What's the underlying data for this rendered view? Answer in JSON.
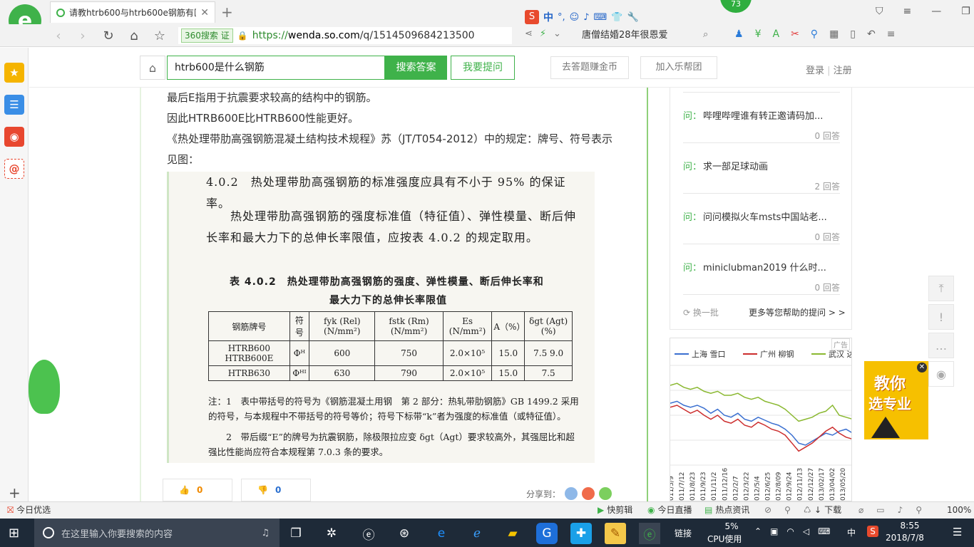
{
  "browser": {
    "tab_title": "请教htrb600与htrb600e钢筋有区",
    "new_tab": "+",
    "badge": "360搜索",
    "badge_cert": "证",
    "url_scheme": "https://",
    "url_host": "wenda.so.com",
    "url_path": "/q/1514509684213500",
    "search_hint": "唐僧结婚28年很恩爱",
    "notif_count": "73",
    "brand_colors": {
      "accent": "#3fb24a",
      "tab_active": "#ffffff"
    }
  },
  "site": {
    "search_value": "htrb600是什么钢筋",
    "search_button": "搜索答案",
    "ask_button": "我要提问",
    "earn_button": "去答题赚金币",
    "join_button": "加入乐帮团",
    "login": "登录",
    "register": "注册"
  },
  "answer": {
    "line1": "最后E指用于抗震要求较高的结构中的钢筋。",
    "line2": "因此HTRB600E比HTRB600性能更好。",
    "line3": "《热处理带肋高强钢筋混凝土结构技术规程》苏（JT/T054-2012）中的规定：牌号、符号表示见图：",
    "figure": {
      "p1": "4.0.2　热处理带肋高强钢筋的标准强度应具有不小于 95% 的保证率。",
      "p2": "　　热处理带肋高强钢筋的强度标准值（特征值）、弹性模量、断后伸长率和最大力下的总伸长率限值，应按表 4.0.2 的规定取用。",
      "table_title1": "表 4.0.2　热处理带肋高强钢筋的强度、弹性模量、断后伸长率和",
      "table_title2": "最大力下的总伸长率限值",
      "headers": [
        "钢筋牌号",
        "符号",
        "fyk (Rel) (N/mm²)",
        "fstk (Rm) (N/mm²)",
        "Es (N/mm²)",
        "A（%）",
        "δgt (Agt) (%)"
      ],
      "rows": [
        [
          "HTRB600 HTRB600E",
          "Φᴴ",
          "600",
          "750",
          "2.0×10⁵",
          "15.0",
          "7.5 9.0"
        ],
        [
          "HTRB630",
          "Φᴴᴵ",
          "630",
          "790",
          "2.0×10⁵",
          "15.0",
          "7.5"
        ]
      ],
      "note1": "注：1　表中带括号的符号为《钢筋混凝土用钢　第 2 部分：热轧带肋钢筋》GB 1499.2 采用的符号，与本规程中不带括号的符号等价；符号下标带“k”者为强度的标准值（或特征值）。",
      "note2": "　　2　带后缀“E”的牌号为抗震钢筋，除极限拉应变 δgt（Agt）要求较高外，其强屈比和超强比性能尚应符合本规程第 7.0.3 条的要求。"
    },
    "likes": "0",
    "dislikes": "0",
    "share_label": "分享到："
  },
  "sidebar": {
    "questions": [
      {
        "prefix": "问：",
        "text": "哔哩哔哩谁有转正邀请码加...",
        "answers": "0 回答"
      },
      {
        "prefix": "问：",
        "text": "求一部足球动画",
        "answers": "2 回答"
      },
      {
        "prefix": "问：",
        "text": "问问模拟火车msts中国站老...",
        "answers": "0 回答"
      },
      {
        "prefix": "问：",
        "text": "miniclubman2019 什么时...",
        "answers": "0 回答"
      }
    ],
    "refresh": "换一批",
    "more": "更多等您帮助的提问 > >"
  },
  "chart_data": {
    "type": "line",
    "legend": [
      "上海 雪口",
      "广州 柳钢",
      "武汉 达"
    ],
    "ad_label": "广告",
    "series": [
      {
        "name": "上海 雪口",
        "color": "#3a6fd0",
        "values": [
          0.62,
          0.64,
          0.6,
          0.58,
          0.6,
          0.57,
          0.52,
          0.56,
          0.5,
          0.48,
          0.52,
          0.46,
          0.44,
          0.48,
          0.45,
          0.42,
          0.4,
          0.36,
          0.3,
          0.22,
          0.2,
          0.24,
          0.28,
          0.32,
          0.3,
          0.34,
          0.36,
          0.32
        ]
      },
      {
        "name": "广州 柳钢",
        "color": "#cc2d2d",
        "values": [
          0.58,
          0.6,
          0.56,
          0.52,
          0.55,
          0.5,
          0.46,
          0.5,
          0.44,
          0.42,
          0.46,
          0.4,
          0.38,
          0.43,
          0.4,
          0.36,
          0.34,
          0.3,
          0.22,
          0.14,
          0.18,
          0.22,
          0.28,
          0.34,
          0.38,
          0.32,
          0.28,
          0.26
        ]
      },
      {
        "name": "武汉 达",
        "color": "#8ab830",
        "values": [
          0.8,
          0.82,
          0.78,
          0.76,
          0.78,
          0.74,
          0.72,
          0.74,
          0.7,
          0.7,
          0.72,
          0.68,
          0.66,
          0.68,
          0.64,
          0.62,
          0.6,
          0.56,
          0.5,
          0.44,
          0.46,
          0.48,
          0.52,
          0.54,
          0.6,
          0.5,
          0.48,
          0.46
        ]
      }
    ],
    "x_labels": [
      "011/5/9",
      "011/7/12",
      "011/8/23",
      "011/9/23",
      "011/11/2",
      "011/12/16",
      "012/2/7",
      "012/3/22",
      "012/5/4",
      "012/6/25",
      "012/8/09",
      "012/9/24",
      "012/11/13",
      "012/12/27",
      "013/02/17",
      "013/04/02",
      "013/05/20"
    ]
  },
  "floating": {
    "ad_text1": "教你",
    "ad_text2": "选专业"
  },
  "statusbar": {
    "left": "今日优选",
    "items": [
      "快剪辑",
      "今日直播",
      "热点资讯",
      "下载"
    ],
    "zoom": "100%"
  },
  "taskbar": {
    "search_placeholder": "在这里输入你要搜索的内容",
    "link_label": "链接",
    "cpu_pct": "5%",
    "cpu_label": "CPU使用",
    "ime": "中",
    "time": "8:55",
    "date": "2018/7/8"
  }
}
